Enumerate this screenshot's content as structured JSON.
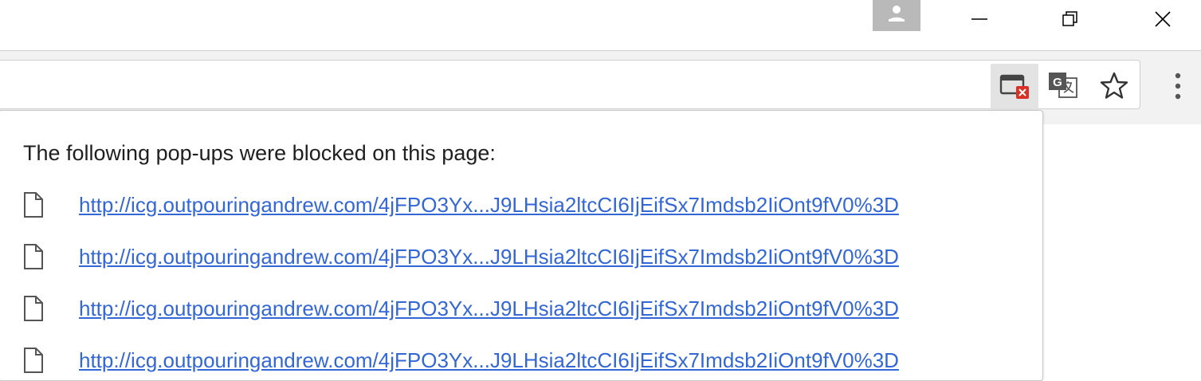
{
  "window": {
    "profile_icon": "person-icon",
    "controls": [
      "minimize-icon",
      "restore-icon",
      "close-icon"
    ]
  },
  "toolbar": {
    "popup_blocked_icon": "popup-blocked-icon",
    "translate_icon": "translate-icon",
    "bookmark_icon": "star-icon",
    "menu_icon": "kebab-menu-icon"
  },
  "popup_bubble": {
    "title": "The following pop-ups were blocked on this page:",
    "items": [
      {
        "url": "http://icg.outpouringandrew.com/4jFPO3Yx...J9LHsia2ltcCI6IjEifSx7Imdsb2IiOnt9fV0%3D"
      },
      {
        "url": "http://icg.outpouringandrew.com/4jFPO3Yx...J9LHsia2ltcCI6IjEifSx7Imdsb2IiOnt9fV0%3D"
      },
      {
        "url": "http://icg.outpouringandrew.com/4jFPO3Yx...J9LHsia2ltcCI6IjEifSx7Imdsb2IiOnt9fV0%3D"
      },
      {
        "url": "http://icg.outpouringandrew.com/4jFPO3Yx...J9LHsia2ltcCI6IjEifSx7Imdsb2IiOnt9fV0%3D"
      }
    ]
  },
  "colors": {
    "link": "#3367d6",
    "blocked_badge": "#d93025",
    "toolbar_bg": "#f2f2f2"
  }
}
